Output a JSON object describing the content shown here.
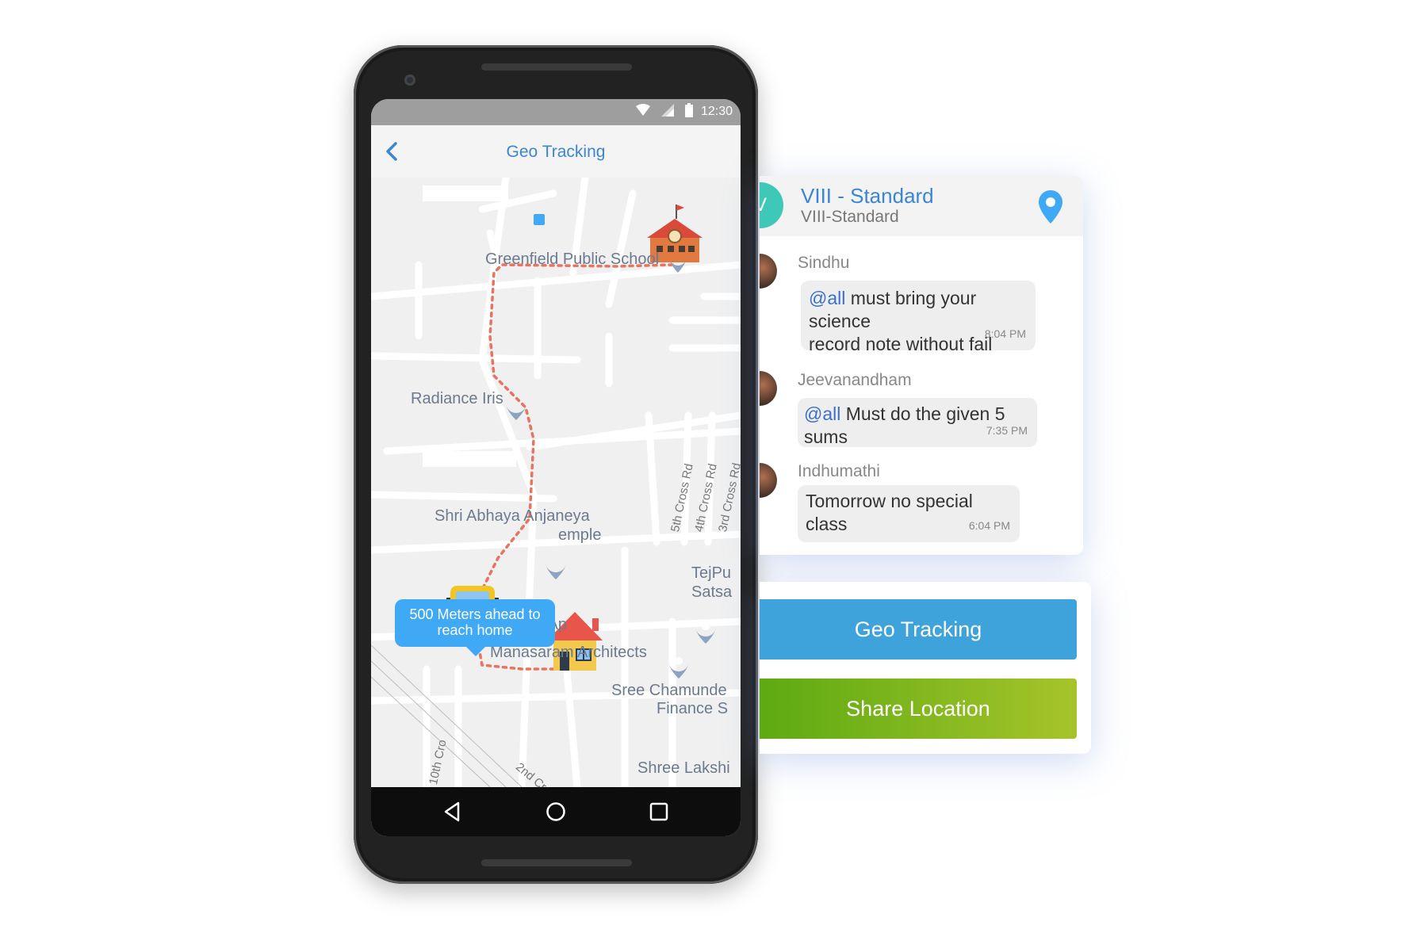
{
  "status": {
    "time": "12:30"
  },
  "app": {
    "title": "Geo Tracking"
  },
  "map": {
    "labels": {
      "school": "Greenfield Public School",
      "radiance": "Radiance Iris",
      "temple_1": "Shri Abhaya Anjaneya",
      "temple_2": "emple",
      "pcb": "PCB Ap",
      "manasaram": "Manasaram Architects",
      "tejpur_1": "TejPu",
      "tejpur_2": "Satsa",
      "chamunde_1": "Sree Chamunde",
      "chamunde_2": "Finance S",
      "lakshmi": "Shree Lakshi",
      "road_5th": "5th Cross Rd",
      "road_4th": "4th Cross Rd",
      "road_3rd": "3rd Cross Rd",
      "road_10th": "10th Cro",
      "road_2nd": "2nd Cr"
    },
    "tooltip": {
      "line1": "500 Meters ahead to",
      "line2": "reach home"
    }
  },
  "chat": {
    "group_initial": "V",
    "group_name": "VIII - Standard",
    "group_subtitle": "VIII-Standard",
    "messages": [
      {
        "sender": "Sindhu",
        "tag": "@all",
        "text_1": " must bring your science",
        "text_2": "record note without fail",
        "time": "8:04 PM"
      },
      {
        "sender": "Jeevanandham",
        "tag": "@all",
        "text": " Must do the given 5 sums",
        "time": "7:35 PM"
      },
      {
        "sender": "Indhumathi",
        "text": "Tomorrow no special class",
        "time": "6:04 PM"
      }
    ]
  },
  "actions": {
    "geo_tracking": "Geo Tracking",
    "share_location": "Share Location"
  },
  "colors": {
    "accent_blue": "#3a86d4",
    "tooltip_blue": "#3fa9f5",
    "geo_button": "#3fa3db",
    "share_start": "#5daa12",
    "share_end": "#a6c42a",
    "route": "#e8735f",
    "avatar_teal": "#3ec8b7"
  }
}
